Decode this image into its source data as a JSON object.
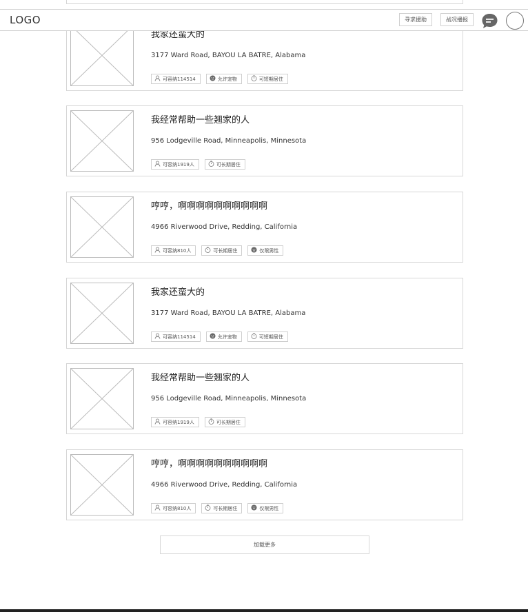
{
  "header": {
    "logo": "LOGO",
    "help_button": "寻求援助",
    "report_button": "战况播报"
  },
  "listings": [
    {
      "title": "我家还蛮大的",
      "address": "3177 Ward Road, BAYOU LA BATRE, Alabama",
      "tags": [
        {
          "icon": "person-icon",
          "label": "可容纳114514"
        },
        {
          "icon": "pet-icon",
          "label": "允许宠物"
        },
        {
          "icon": "timer-icon",
          "label": "可短期居住"
        }
      ]
    },
    {
      "title": "我经常帮助一些翘家的人",
      "address": "956 Lodgeville Road, Minneapolis, Minnesota",
      "tags": [
        {
          "icon": "person-icon",
          "label": "可容纳1919人"
        },
        {
          "icon": "timer-icon",
          "label": "可长期居住"
        }
      ]
    },
    {
      "title": "哼哼，啊啊啊啊啊啊啊啊啊啊",
      "address": "4966 Riverwood Drive, Redding, California",
      "tags": [
        {
          "icon": "person-icon",
          "label": "可容纳810人"
        },
        {
          "icon": "timer-icon",
          "label": "可长期居住"
        },
        {
          "icon": "male-icon",
          "label": "仅限男性"
        }
      ]
    },
    {
      "title": "我家还蛮大的",
      "address": "3177 Ward Road, BAYOU LA BATRE, Alabama",
      "tags": [
        {
          "icon": "person-icon",
          "label": "可容纳114514"
        },
        {
          "icon": "pet-icon",
          "label": "允许宠物"
        },
        {
          "icon": "timer-icon",
          "label": "可短期居住"
        }
      ]
    },
    {
      "title": "我经常帮助一些翘家的人",
      "address": "956 Lodgeville Road, Minneapolis, Minnesota",
      "tags": [
        {
          "icon": "person-icon",
          "label": "可容纳1919人"
        },
        {
          "icon": "timer-icon",
          "label": "可长期居住"
        }
      ]
    },
    {
      "title": "哼哼，啊啊啊啊啊啊啊啊啊啊",
      "address": "4966 Riverwood Drive, Redding, California",
      "tags": [
        {
          "icon": "person-icon",
          "label": "可容纳810人"
        },
        {
          "icon": "timer-icon",
          "label": "可长期居住"
        },
        {
          "icon": "male-icon",
          "label": "仅限男性"
        }
      ]
    }
  ],
  "load_more": "加载更多"
}
